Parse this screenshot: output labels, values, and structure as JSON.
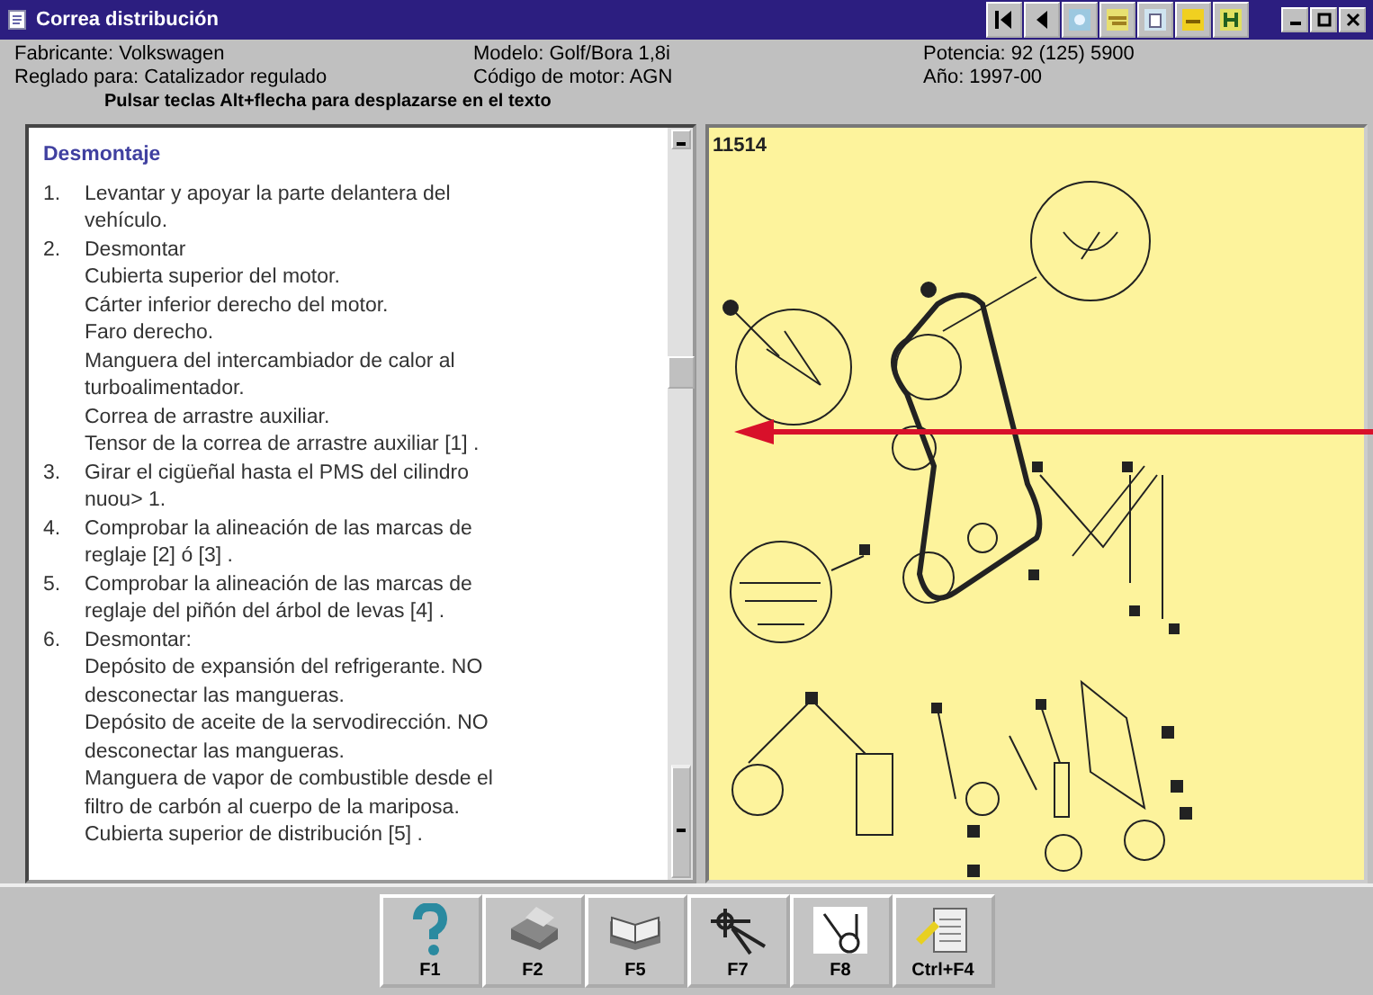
{
  "window": {
    "title": "Correa distribución"
  },
  "info": [
    {
      "label": "Fabricante:",
      "value": "Volkswagen"
    },
    {
      "label": "Modelo:",
      "value": "Golf/Bora 1,8i"
    },
    {
      "label": "Potencia:",
      "value": "92 (125) 5900"
    },
    {
      "label": "Reglado para:",
      "value": "Catalizador regulado"
    },
    {
      "label": "Código de motor:",
      "value": "AGN"
    },
    {
      "label": "Año:",
      "value": "1997-00"
    }
  ],
  "hint": "Pulsar teclas Alt+flecha para desplazarse en el texto",
  "section_title": "Desmontaje",
  "steps": [
    {
      "number": "1.",
      "lines": [
        "Levantar y apoyar la parte delantera del",
        "vehículo."
      ]
    },
    {
      "number": "2.",
      "lines": [
        "Desmontar",
        "Cubierta superior del motor.",
        "Cárter inferior derecho del motor.",
        "Faro derecho.",
        "Manguera del intercambiador de calor al",
        "turboalimentador.",
        "Correa de arrastre auxiliar.",
        "Tensor de la correa de arrastre auxiliar [1] ."
      ]
    },
    {
      "number": "3.",
      "lines": [
        "Girar el cigüeñal hasta el PMS del cilindro",
        "nuou> 1."
      ]
    },
    {
      "number": "4.",
      "lines": [
        "Comprobar la alineación de las marcas de",
        "reglaje [2] ó [3] ."
      ]
    },
    {
      "number": "5.",
      "lines": [
        "Comprobar la alineación de las marcas de",
        "reglaje del piñón del árbol de levas [4] ."
      ]
    },
    {
      "number": "6.",
      "lines": [
        "Desmontar:",
        "Depósito de expansión del refrigerante. NO",
        "desconectar las mangueras.",
        "Depósito de aceite de la servodirección. NO",
        "desconectar las mangueras.",
        "Manguera de vapor de combustible desde el",
        "filtro de carbón al cuerpo de la mariposa.",
        "Cubierta superior de distribución [5] ."
      ]
    }
  ],
  "diagram": {
    "label": "11514"
  },
  "toolbar": [
    {
      "kind": "help",
      "key": "F1"
    },
    {
      "kind": "print",
      "key": "F2"
    },
    {
      "kind": "book",
      "key": "F5"
    },
    {
      "kind": "tool",
      "key": "F7"
    },
    {
      "kind": "belt",
      "key": "F8"
    },
    {
      "kind": "notes",
      "key": "Ctrl+F4"
    }
  ]
}
